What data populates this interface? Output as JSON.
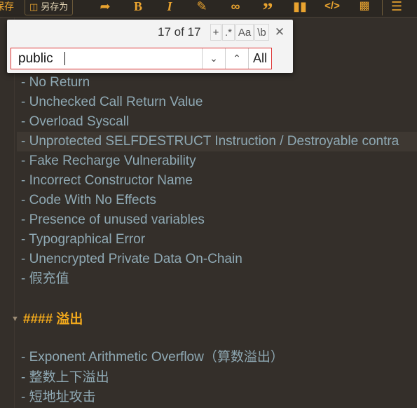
{
  "toolbar": {
    "save_partial_label": "保存",
    "save_as_label": "另存为",
    "save_as_icon": "save-as-icon",
    "icons": [
      "redo-icon",
      "bold-icon",
      "italic-icon",
      "highlighter-icon",
      "link-icon",
      "quote-icon",
      "blockquote-icon",
      "code-icon",
      "image-file-icon",
      "more-icon",
      "list-icon"
    ],
    "accent_color": "#e9a32f"
  },
  "find": {
    "count": "17 of 17",
    "options": {
      "plus": "+",
      "regex": ".*",
      "case": "Aa",
      "word": "\\b"
    },
    "query": "public",
    "all_label": "All"
  },
  "content": {
    "list1": [
      "- No Return",
      "- Unchecked Call Return Value",
      "- Overload Syscall",
      "- Unprotected SELFDESTRUCT Instruction / Destroyable contra",
      "- Fake Recharge Vulnerability",
      "- Incorrect Constructor Name",
      "- Code With No Effects",
      "- Presence of unused variables",
      "- Typographical Error",
      "- Unencrypted Private Data On-Chain",
      "- 假充值"
    ],
    "heading": "#### 溢出",
    "list2": [
      "- Exponent Arithmetic Overflow（算数溢出）",
      "- 整数上下溢出",
      "- 短地址攻击"
    ]
  }
}
